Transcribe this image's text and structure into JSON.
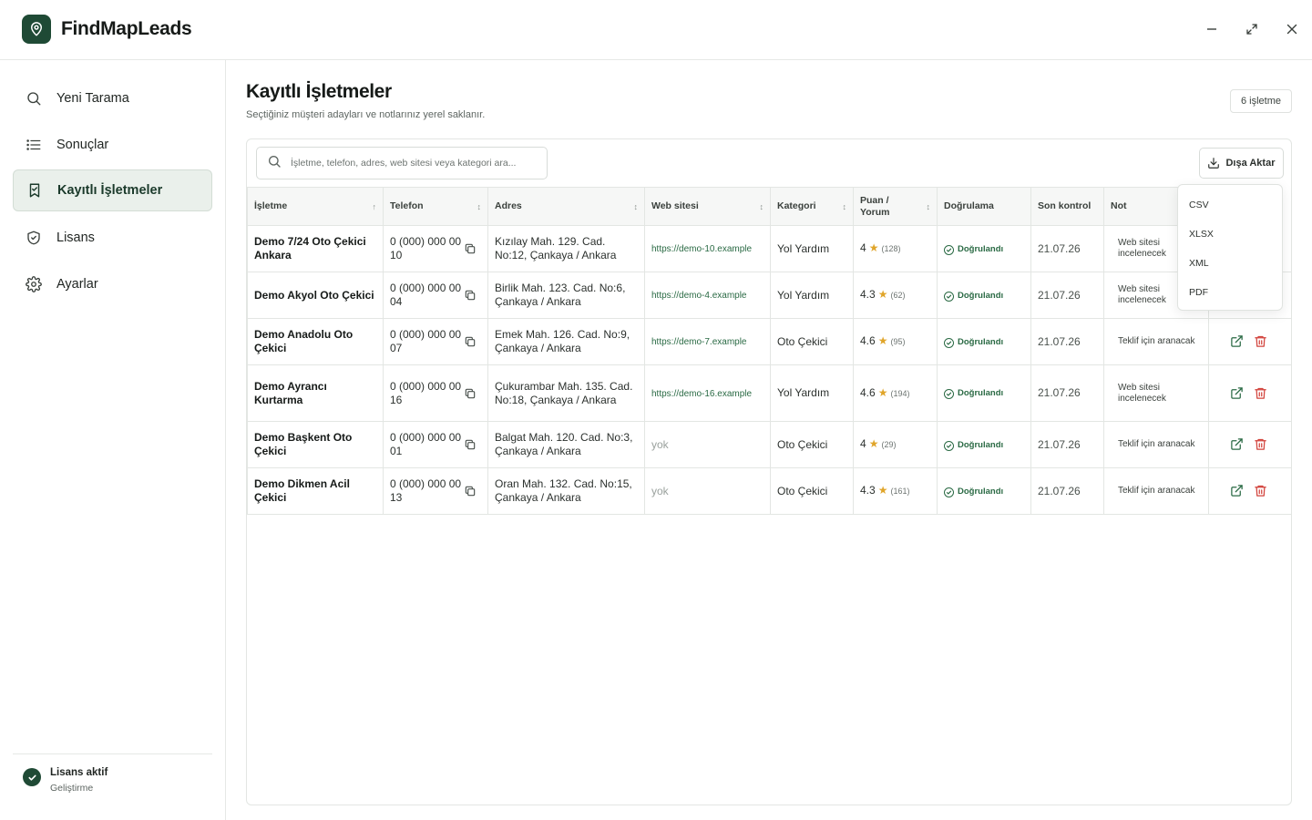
{
  "app": {
    "title": "FindMapLeads"
  },
  "sidebar": {
    "items": [
      {
        "label": "Yeni Tarama",
        "icon": "search-icon"
      },
      {
        "label": "Sonuçlar",
        "icon": "list-icon"
      },
      {
        "label": "Kayıtlı İşletmeler",
        "icon": "bookmark-icon",
        "active": true
      },
      {
        "label": "Lisans",
        "icon": "shield-icon"
      },
      {
        "label": "Ayarlar",
        "icon": "gear-icon"
      }
    ],
    "license": {
      "title": "Lisans aktif",
      "subtitle": "Geliştirme"
    }
  },
  "main": {
    "title": "Kayıtlı İşletmeler",
    "subtitle": "Seçtiğiniz müşteri adayları ve notlarınız yerel saklanır.",
    "count": "6 işletme",
    "search": {
      "placeholder": "İşletme, telefon, adres, web sitesi veya kategori ara..."
    },
    "export_label": "Dışa Aktar",
    "export_options": [
      "CSV",
      "XLSX",
      "XML",
      "PDF"
    ]
  },
  "table": {
    "columns": {
      "name": "İşletme",
      "phone": "Telefon",
      "address": "Adres",
      "website": "Web sitesi",
      "category": "Kategori",
      "rating": "Puan / Yorum",
      "verify": "Doğrulama",
      "last_check": "Son kontrol",
      "note": "Not"
    },
    "rows": [
      {
        "name": "Demo 7/24 Oto Çekici Ankara",
        "phone": "0 (000) 000 00 10",
        "address": "Kızılay Mah. 129. Cad. No:12, Çankaya / Ankara",
        "website": "https://demo-10.example",
        "category": "Yol Yardım",
        "rating": "4",
        "reviews": "(128)",
        "verify": "Doğrulandı",
        "last_check": "21.07.26",
        "note": "Web sitesi incelenecek"
      },
      {
        "name": "Demo Akyol Oto Çekici",
        "phone": "0 (000) 000 00 04",
        "address": "Birlik Mah. 123. Cad. No:6, Çankaya / Ankara",
        "website": "https://demo-4.example",
        "category": "Yol Yardım",
        "rating": "4.3",
        "reviews": "(62)",
        "verify": "Doğrulandı",
        "last_check": "21.07.26",
        "note": "Web sitesi incelenecek"
      },
      {
        "name": "Demo Anadolu Oto Çekici",
        "phone": "0 (000) 000 00 07",
        "address": "Emek Mah. 126. Cad. No:9, Çankaya / Ankara",
        "website": "https://demo-7.example",
        "category": "Oto Çekici",
        "rating": "4.6",
        "reviews": "(95)",
        "verify": "Doğrulandı",
        "last_check": "21.07.26",
        "note": "Teklif için aranacak"
      },
      {
        "name": "Demo Ayrancı Kurtarma",
        "phone": "0 (000) 000 00 16",
        "address": "Çukurambar Mah. 135. Cad. No:18, Çankaya / Ankara",
        "website": "https://demo-16.example",
        "category": "Yol Yardım",
        "rating": "4.6",
        "reviews": "(194)",
        "verify": "Doğrulandı",
        "last_check": "21.07.26",
        "note": "Web sitesi incelenecek"
      },
      {
        "name": "Demo Başkent Oto Çekici",
        "phone": "0 (000) 000 00 01",
        "address": "Balgat Mah. 120. Cad. No:3, Çankaya / Ankara",
        "website": "yok",
        "category": "Oto Çekici",
        "rating": "4",
        "reviews": "(29)",
        "verify": "Doğrulandı",
        "last_check": "21.07.26",
        "note": "Teklif için aranacak"
      },
      {
        "name": "Demo Dikmen Acil Çekici",
        "phone": "0 (000) 000 00 13",
        "address": "Oran Mah. 132. Cad. No:15, Çankaya / Ankara",
        "website": "yok",
        "category": "Oto Çekici",
        "rating": "4.3",
        "reviews": "(161)",
        "verify": "Doğrulandı",
        "last_check": "21.07.26",
        "note": "Teklif için aranacak"
      }
    ]
  },
  "colors": {
    "brand": "#1f4a35",
    "link": "#2a6a44",
    "star": "#e0a52a",
    "danger": "#d2433c"
  }
}
